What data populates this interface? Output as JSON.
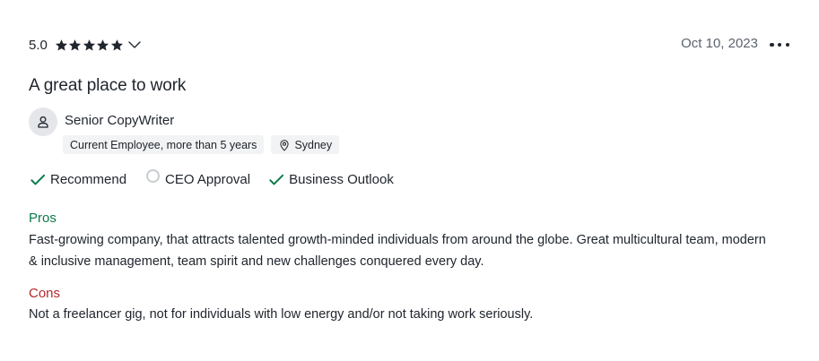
{
  "review": {
    "rating": "5.0",
    "stars": 5,
    "date": "Oct 10, 2023",
    "title": "A great place to work",
    "reviewer": {
      "job_title": "Senior CopyWriter",
      "employment": "Current Employee, more than 5 years",
      "location": "Sydney"
    },
    "approvals": [
      {
        "label": "Recommend",
        "state": "positive"
      },
      {
        "label": "CEO Approval",
        "state": "neutral"
      },
      {
        "label": "Business Outlook",
        "state": "positive"
      }
    ],
    "pros": {
      "label": "Pros",
      "text": "Fast-growing company, that attracts talented growth-minded individuals from around the globe. Great multicultural team, modern & inclusive management, team spirit and new challenges conquered every day."
    },
    "cons": {
      "label": "Cons",
      "text": "Not a freelancer gig, not for individuals with low energy and/or not taking work seriously."
    }
  },
  "colors": {
    "text": "#20262e",
    "muted": "#5c6370",
    "positive": "#0c7a4b",
    "pros": "#0c7a4b",
    "cons": "#b3292b",
    "tag_bg": "#f2f3f4",
    "neutral_ring": "#c9cccf"
  },
  "icons": {
    "star": "star-icon",
    "chevron": "chevron-down-icon",
    "more": "more-horizontal-icon",
    "avatar": "user-icon",
    "location": "location-pin-icon",
    "positive": "checkmark-icon",
    "neutral": "empty-circle-icon"
  }
}
